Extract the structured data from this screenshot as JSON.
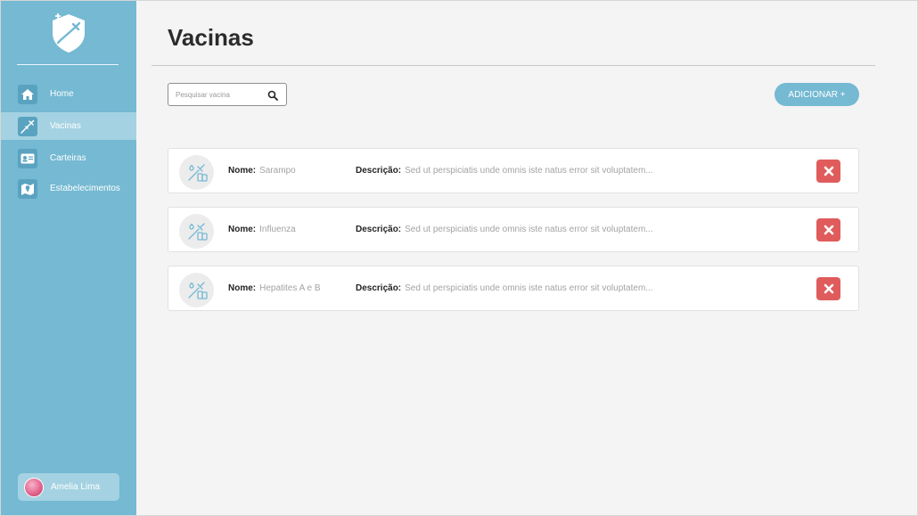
{
  "sidebar": {
    "items": [
      {
        "label": "Home",
        "icon": "home-icon"
      },
      {
        "label": "Vacinas",
        "icon": "syringe-icon",
        "active": true
      },
      {
        "label": "Carteiras",
        "icon": "id-card-icon"
      },
      {
        "label": "Estabelecimentos",
        "icon": "map-icon"
      }
    ],
    "user": {
      "name": "Amelia Lima"
    }
  },
  "header": {
    "title": "Vacinas"
  },
  "search": {
    "placeholder": "Pesquisar vacina",
    "value": ""
  },
  "actions": {
    "add_label": "ADICIONAR +"
  },
  "labels": {
    "name": "Nome:",
    "description": "Descrição:"
  },
  "vaccines": [
    {
      "name": "Sarampo",
      "description": "Sed ut perspiciatis unde omnis iste natus error sit voluptatem..."
    },
    {
      "name": "Influenza",
      "description": "Sed ut perspiciatis unde omnis iste natus error sit voluptatem..."
    },
    {
      "name": "Hepatites A e B",
      "description": "Sed ut perspiciatis unde omnis iste natus error sit voluptatem..."
    }
  ],
  "colors": {
    "sidebar": "#75b9d3",
    "sidebar_active": "#a4d2e2",
    "accent": "#75b9d3",
    "delete": "#e05c5c",
    "background": "#f4f4f4"
  }
}
